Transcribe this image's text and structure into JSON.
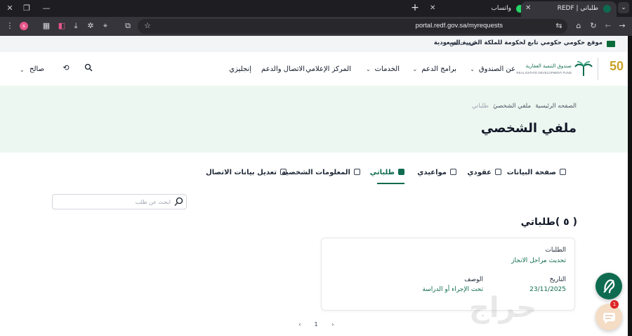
{
  "browser": {
    "tabs": [
      {
        "title": "طلباتي | REDF",
        "active": true
      },
      {
        "title": "واتساب",
        "active": false
      }
    ],
    "url": "portal.redf.gov.sa/myrequests",
    "profile_initial": "s"
  },
  "gov_banner": {
    "text": "موقع حكومي حكومي تابع لحكومة للملكة العربية السعودية",
    "verify_link": "كيف تتحقق"
  },
  "header": {
    "logo_anniversary": "50",
    "logo_name_ar": "صندوق التنمية العقارية",
    "logo_name_en": "REAL ESTATE DEVELOPMENT FUND",
    "nav": [
      {
        "label": "عن الصندوق",
        "has_dropdown": true
      },
      {
        "label": "برامج الدعم",
        "has_dropdown": true
      },
      {
        "label": "الخدمات",
        "has_dropdown": true
      },
      {
        "label": "المركز الإعلامي",
        "has_dropdown": false
      },
      {
        "label": "الاتصال والدعم",
        "has_dropdown": false
      },
      {
        "label": "إنجليزي",
        "has_dropdown": false
      }
    ],
    "user_name": "صالح"
  },
  "hero": {
    "breadcrumb": [
      "الصفحه الرئيسية",
      "ملفي الشخصي",
      "طلباتي"
    ],
    "title": "ملفي الشخصي"
  },
  "profile_tabs": [
    {
      "label": "صفحة البيانات",
      "active": false
    },
    {
      "label": "عقودي",
      "active": false
    },
    {
      "label": "مواعيدي",
      "active": false
    },
    {
      "label": "طلباتي",
      "active": true
    },
    {
      "label": "المعلومات الشخصية",
      "active": false
    },
    {
      "label": "تعديل بيانات الاتصال",
      "active": false
    }
  ],
  "search": {
    "placeholder": "ابحث عن طلب",
    "value": ""
  },
  "requests": {
    "title": "( ٥ )طلباتي",
    "card": {
      "requests_label": "الطلبات",
      "request_name": "تحديث مراحل الانجاز",
      "date_label": "التاريخ",
      "date_value": "23/11/2025",
      "desc_label": "الوصف",
      "desc_value": "تحت الإجراء أو الدراسة"
    }
  },
  "pagination": {
    "prev": "‹",
    "page": "1",
    "next": "›"
  },
  "chat": {
    "badge": "1"
  },
  "watermark": "حراج",
  "colors": {
    "brand_green": "#0f6b4f",
    "hero_bg": "#edf7f1",
    "gold": "#c9a227"
  }
}
